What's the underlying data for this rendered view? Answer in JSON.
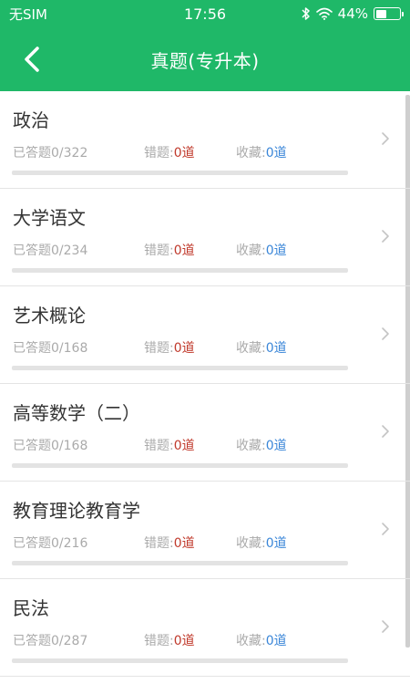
{
  "status": {
    "carrier": "无SIM",
    "time": "17:56",
    "battery_percent_label": "44%",
    "battery_level": 0.44
  },
  "nav": {
    "title": "真题(专升本)"
  },
  "labels": {
    "answered_prefix": "已答题",
    "wrong_prefix": "错题:",
    "fav_prefix": "收藏:"
  },
  "subjects": [
    {
      "name": "政治",
      "answered": "0/322",
      "wrong": "0道",
      "fav": "0道",
      "progress": 0
    },
    {
      "name": "大学语文",
      "answered": "0/234",
      "wrong": "0道",
      "fav": "0道",
      "progress": 0
    },
    {
      "name": "艺术概论",
      "answered": "0/168",
      "wrong": "0道",
      "fav": "0道",
      "progress": 0
    },
    {
      "name": "高等数学（二）",
      "answered": "0/168",
      "wrong": "0道",
      "fav": "0道",
      "progress": 0
    },
    {
      "name": "教育理论教育学",
      "answered": "0/216",
      "wrong": "0道",
      "fav": "0道",
      "progress": 0
    },
    {
      "name": "民法",
      "answered": "0/287",
      "wrong": "0道",
      "fav": "0道",
      "progress": 0
    }
  ],
  "colors": {
    "brand_green": "#1fb868",
    "wrong_red": "#c0392b",
    "fav_blue": "#3a86d8"
  }
}
